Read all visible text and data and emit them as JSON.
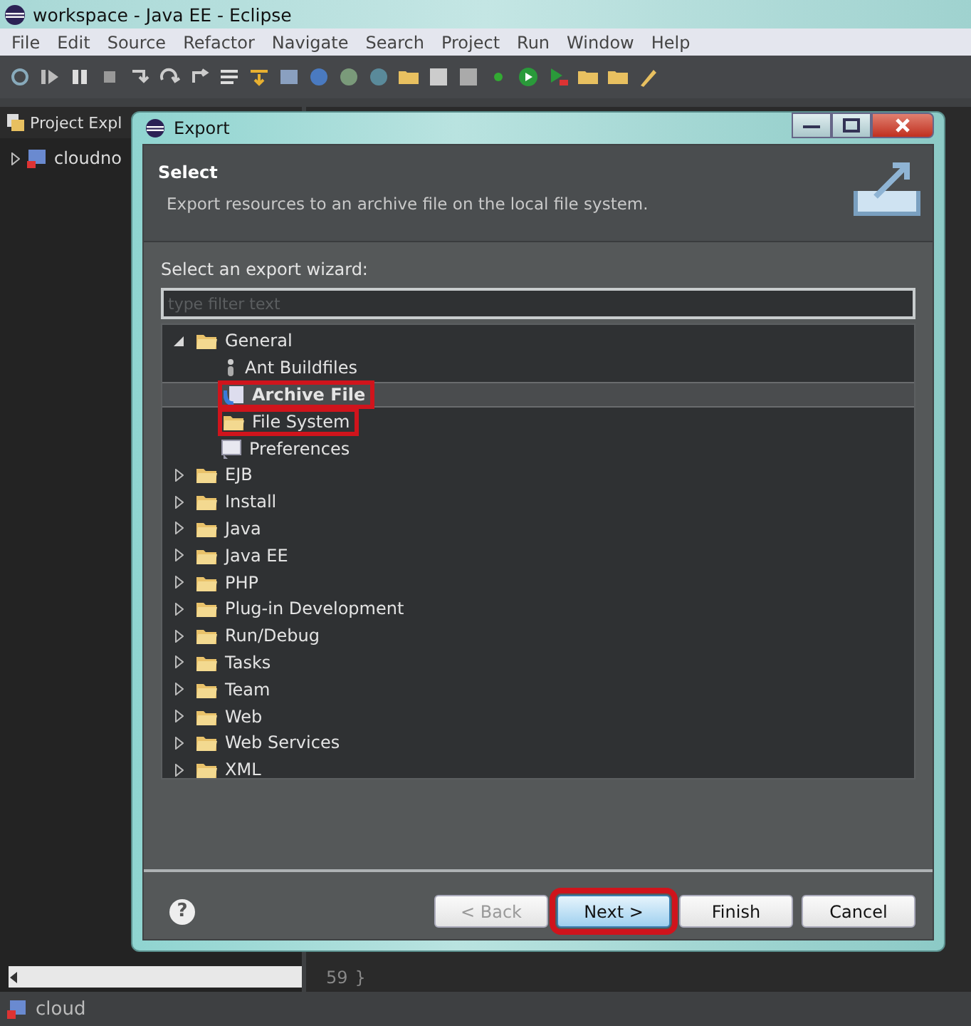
{
  "window": {
    "title": "workspace - Java EE - Eclipse"
  },
  "menu": [
    "File",
    "Edit",
    "Source",
    "Refactor",
    "Navigate",
    "Search",
    "Project",
    "Run",
    "Window",
    "Help"
  ],
  "project_explorer": {
    "tab": "Project Expl",
    "items": [
      {
        "label": "cloudno",
        "expanded": false,
        "selected": false
      }
    ]
  },
  "editor": {
    "line_number": "59",
    "code": "}"
  },
  "dialog": {
    "title": "Export",
    "header_title": "Select",
    "header_description": "Export resources to an archive file on the local file system.",
    "wizard_label": "Select an export wizard:",
    "filter": {
      "placeholder": "type filter text"
    },
    "tree": [
      {
        "label": "General",
        "expanded": true,
        "selected": false,
        "children": [
          {
            "label": "Ant Buildfiles",
            "kind": "ant",
            "selected": false,
            "highlighted": false
          },
          {
            "label": "Archive File",
            "kind": "archive",
            "selected": true,
            "highlighted": true
          },
          {
            "label": "File System",
            "kind": "folder",
            "selected": false,
            "highlighted": true
          },
          {
            "label": "Preferences",
            "kind": "preferences",
            "selected": false,
            "highlighted": false
          }
        ]
      },
      {
        "label": "EJB",
        "expanded": false,
        "selected": false
      },
      {
        "label": "Install",
        "expanded": false,
        "selected": false
      },
      {
        "label": "Java",
        "expanded": false,
        "selected": false
      },
      {
        "label": "Java EE",
        "expanded": false,
        "selected": false
      },
      {
        "label": "PHP",
        "expanded": false,
        "selected": false
      },
      {
        "label": "Plug-in Development",
        "expanded": false,
        "selected": false
      },
      {
        "label": "Run/Debug",
        "expanded": false,
        "selected": false
      },
      {
        "label": "Tasks",
        "expanded": false,
        "selected": false
      },
      {
        "label": "Team",
        "expanded": false,
        "selected": false
      },
      {
        "label": "Web",
        "expanded": false,
        "selected": false
      },
      {
        "label": "Web Services",
        "expanded": false,
        "selected": false
      },
      {
        "label": "XML",
        "expanded": false,
        "selected": false
      }
    ],
    "help": "?",
    "buttons": [
      {
        "label": "< Back",
        "disabled": true,
        "highlighted": false
      },
      {
        "label": "Next >",
        "disabled": false,
        "highlighted": true
      },
      {
        "label": "Finish",
        "disabled": false,
        "highlighted": false
      },
      {
        "label": "Cancel",
        "disabled": false,
        "highlighted": false
      }
    ]
  },
  "status_bar": {
    "text": "cloud"
  }
}
